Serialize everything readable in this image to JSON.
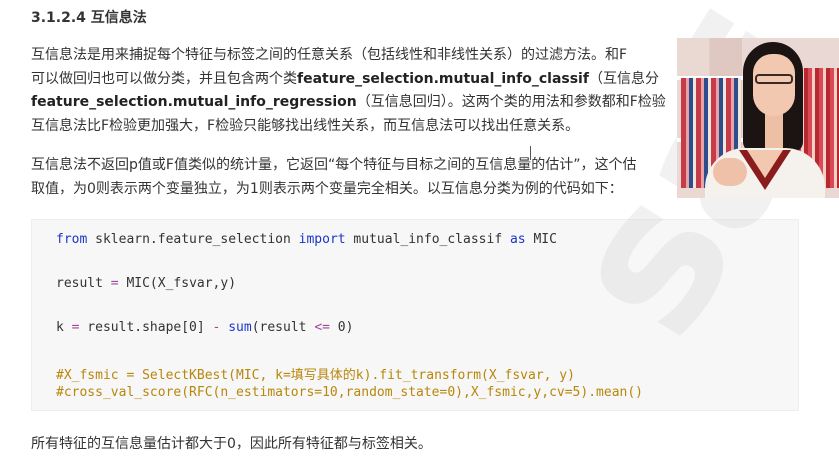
{
  "section": {
    "heading": "3.1.2.4 互信息法"
  },
  "para1": {
    "l1": "互信息法是用来捕捉每个特征与标签之间的任意关系（包括线性和非线性关系）的过滤方法。和F",
    "l2a": "可以做回归也可以做分类，并且包含两个类",
    "l2b": "feature_selection.mutual_info_classif",
    "l2c": "（互信息分",
    "l3a": "feature_selection.mutual_info_regression",
    "l3b": "（互信息回归）。这两个类的用法和参数都和F检验",
    "l4": "互信息法比F检验更加强大，F检验只能够找出线性关系，而互信息法可以找出任意关系。"
  },
  "para2": {
    "l1": "互信息法不返回p值或F值类似的统计量，它返回“每个特征与目标之间的互信息量的估计”，这个估",
    "l2": "取值，为0则表示两个变量独立，为1则表示两个变量完全相关。以互信息分类为例的代码如下："
  },
  "code": {
    "line1_kw1": "from",
    "line1_mod": " sklearn.feature_selection ",
    "line1_kw2": "import",
    "line1_name": " mutual_info_classif ",
    "line1_kw3": "as",
    "line1_alias": " MIC",
    "line2_a": "result ",
    "line2_op": "=",
    "line2_b": " MIC(X_fsvar,y)",
    "line3_a": "k ",
    "line3_op1": "=",
    "line3_b": " result.shape[0] ",
    "line3_op2": "-",
    "line3_sp": " ",
    "line3_kw": "sum",
    "line3_c": "(result ",
    "line3_op3": "<=",
    "line3_d": " 0)",
    "line4": "#X_fsmic = SelectKBest(MIC, k=填写具体的k).fit_transform(X_fsvar, y)",
    "line5": "#cross_val_score(RFC(n_estimators=10,random_state=0),X_fsmic,y,cv=5).mean()"
  },
  "para3": {
    "text": "所有特征的互信息量估计都大于0，因此所有特征都与标签相关。"
  },
  "colors": {
    "keyword": "#1a37c9",
    "operator": "#a0459e",
    "comment": "#b8860b",
    "code_bg": "#f7f7f7"
  }
}
